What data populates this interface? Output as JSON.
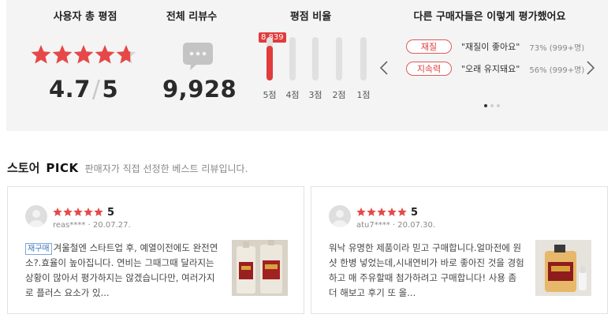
{
  "summary": {
    "titles": {
      "score": "사용자 총 평점",
      "reviews": "전체 리뷰수",
      "ratio": "평점 비율",
      "keywords": "다른 구매자들은 이렇게 평가했어요"
    },
    "score": {
      "value": "4.7",
      "slash": "/",
      "max": "5",
      "stars": 4.7
    },
    "review_count": "9,928",
    "ratio": {
      "badge": "8,839",
      "bars": [
        {
          "label": "5점",
          "fill": 0.8
        },
        {
          "label": "4점",
          "fill": 0
        },
        {
          "label": "3점",
          "fill": 0
        },
        {
          "label": "2점",
          "fill": 0
        },
        {
          "label": "1점",
          "fill": 0
        }
      ]
    },
    "keywords": [
      {
        "tag": "재질",
        "text": "\"재질이 좋아요\"",
        "pct": "73% (999+명)"
      },
      {
        "tag": "지속력",
        "text": "\"오래 유지돼요\"",
        "pct": "56% (999+명)"
      }
    ],
    "carousel_page": 1,
    "carousel_pages": 3
  },
  "store_pick": {
    "title_a": "스토어",
    "title_b": "PICK",
    "desc": "판매자가 직접 선정한 베스트 리뷰입니다."
  },
  "reviews": [
    {
      "score": "5",
      "user": "reas****",
      "date": "20.07.27.",
      "badge": "재구매",
      "text": "겨울철엔 스타트업 후, 예열이전에도 완전연소?.효율이 높아집니다. 연비는 그때그때 달라지는 상황이 많아서 평가하지는 않겠습니다만, 여러가지로 플러스 요소가 있..."
    },
    {
      "score": "5",
      "user": "atu7****",
      "date": "20.07.30.",
      "text": "워낙 유명한 제품이라 믿고 구매합니다.얼마전에 원샷 한병 넣었는데,시내연비가 바로 좋아진 것을 경험하고 매 주유할때 첨가하려고 구매합니다! 사용 좀 더 해보고 후기 또 올..."
    }
  ],
  "colors": {
    "accent": "#e03c3c",
    "star": "#e64848",
    "rebuy": "#3f74bd"
  },
  "icons": {
    "rating": "star-icon",
    "reviews": "speech-bubble-icon",
    "prev": "chevron-left-icon",
    "next": "chevron-right-icon"
  }
}
